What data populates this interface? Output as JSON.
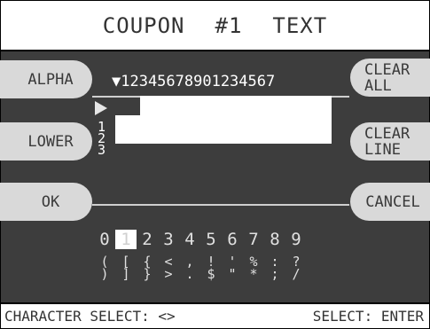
{
  "title": {
    "coupon": "COUPON",
    "number": "#1",
    "text": "TEXT"
  },
  "softkeys": {
    "alpha": "ALPHA",
    "lower": "LOWER",
    "ok": "OK",
    "clear_all_1": "CLEAR",
    "clear_all_2": "ALL",
    "clear_line_1": "CLEAR",
    "clear_line_2": "LINE",
    "cancel": "CANCEL"
  },
  "ruler": "▼12345678901234567",
  "line_numbers": [
    "1",
    "2",
    "3"
  ],
  "digits": [
    "0",
    "1",
    "2",
    "3",
    "4",
    "5",
    "6",
    "7",
    "8",
    "9"
  ],
  "selected_index": 1,
  "symbols_top": [
    "(",
    "[",
    "{",
    "<",
    ",",
    "!",
    "'",
    "%",
    ":",
    "?"
  ],
  "symbols_bottom": [
    ")",
    "]",
    "}",
    ">",
    ".",
    "$",
    "\"",
    "*",
    ";",
    "/"
  ],
  "status": {
    "left": "CHARACTER SELECT: <>",
    "right": "SELECT: ENTER"
  }
}
